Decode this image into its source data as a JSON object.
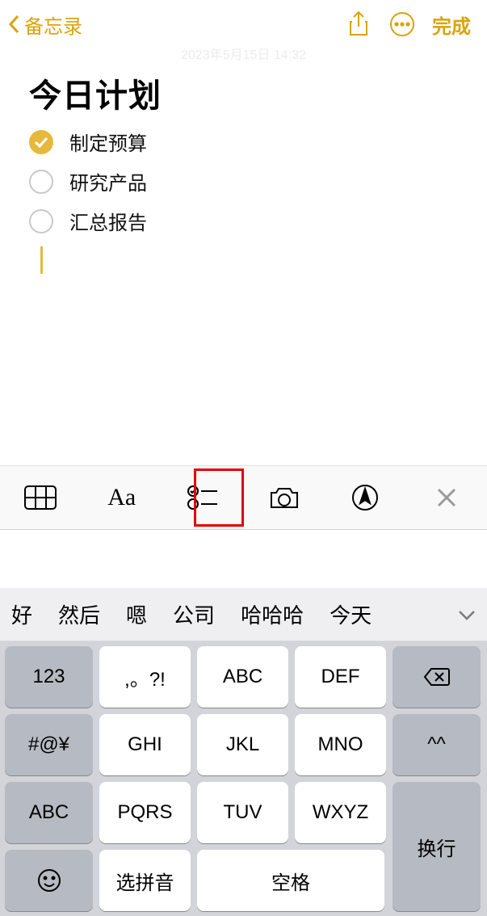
{
  "header": {
    "back": "备忘录",
    "done": "完成"
  },
  "date": "2023年5月15日 14:32",
  "note": {
    "title": "今日计划",
    "items": [
      {
        "text": "制定预算",
        "checked": true
      },
      {
        "text": "研究产品",
        "checked": false
      },
      {
        "text": "汇总报告",
        "checked": false
      }
    ]
  },
  "format_bar": {
    "aa": "Aa"
  },
  "keyboard": {
    "candidates": [
      "好",
      "然后",
      "嗯",
      "公司",
      "哈哈哈",
      "今天"
    ],
    "rows": {
      "r1": [
        "123",
        ",。?!",
        "ABC",
        "DEF"
      ],
      "r2": [
        "#@¥",
        "GHI",
        "JKL",
        "MNO",
        "^^"
      ],
      "r3": [
        "ABC",
        "PQRS",
        "TUV",
        "WXYZ"
      ],
      "r4": {
        "pinyin": "选拼音",
        "space": "空格",
        "return": "换行"
      }
    }
  }
}
